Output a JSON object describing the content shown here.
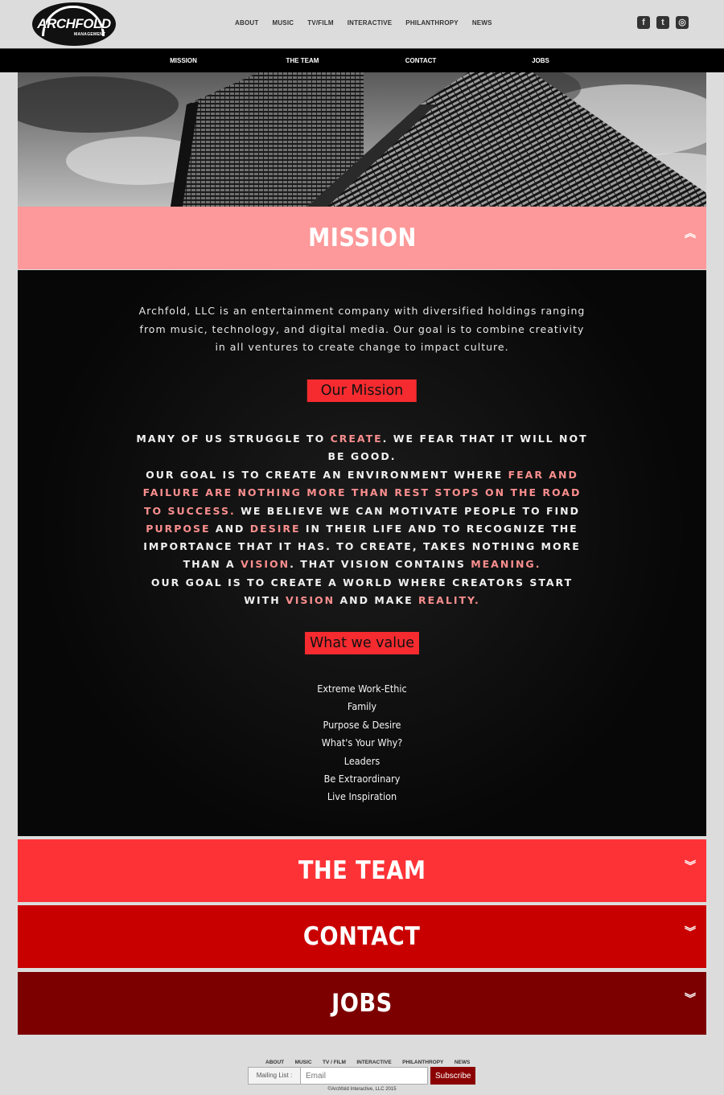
{
  "brand": {
    "logo_word": "ARCHFOLD",
    "logo_sub": "MANAGEMENT"
  },
  "topnav": [
    "ABOUT",
    "MUSIC",
    "TV/FILM",
    "INTERACTIVE",
    "PHILANTHROPY",
    "NEWS"
  ],
  "social": {
    "facebook": "f",
    "twitter": "t",
    "instagram": "◎"
  },
  "secnav": [
    "MISSION",
    "THE TEAM",
    "CONTACT",
    "JOBS"
  ],
  "mission": {
    "title": "MISSION",
    "intro": "Archfold, LLC is an entertainment company with diversified holdings ranging from music, technology, and digital media. Our goal is to combine creativity in all ventures to create change to impact culture.",
    "our_mission_label": "Our Mission",
    "p1": {
      "a": "MANY OF US STRUGGLE TO ",
      "b": "CREATE",
      "c": ". WE FEAR THAT IT WILL NOT BE GOOD."
    },
    "p2": {
      "a": "OUR GOAL IS TO CREATE AN ENVIRONMENT WHERE ",
      "b": "FEAR AND FAILURE ARE NOTHING MORE THAN REST STOPS ON THE ROAD TO SUCCESS.",
      "c": " WE BELIEVE WE CAN MOTIVATE PEOPLE TO FIND ",
      "d": "PURPOSE",
      "e": " AND ",
      "f": "DESIRE",
      "g": " IN THEIR LIFE AND TO RECOGNIZE THE IMPORTANCE THAT IT HAS. TO CREATE, TAKES NOTHING MORE THAN A ",
      "h": "VISION",
      "i": ". THAT VISION CONTAINS ",
      "j": "MEANING."
    },
    "p3": {
      "a": "OUR GOAL IS TO CREATE A WORLD WHERE CREATORS START WITH ",
      "b": "VISION",
      "c": " AND MAKE ",
      "d": "REALITY."
    },
    "values_label": "What we value",
    "values": [
      "Extreme Work-Ethic",
      "Family",
      "Purpose & Desire",
      "What's Your Why?",
      "Leaders",
      "Be Extraordinary",
      "Live Inspiration"
    ]
  },
  "panels": [
    {
      "title": "THE TEAM",
      "color": "#fd3236"
    },
    {
      "title": "CONTACT",
      "color": "#c90000"
    },
    {
      "title": "JOBS",
      "color": "#7d0000"
    }
  ],
  "colors": {
    "mission_head": "#fd999a",
    "highlight": "#fa8e8e",
    "pill": "#f52b2f"
  },
  "footer": {
    "nav": [
      "ABOUT",
      "MUSIC",
      "TV / FILM",
      "INTERACTIVE",
      "PHILANTHROPY",
      "NEWS"
    ],
    "mailing_label": "Mailing List :",
    "email_placeholder": "Email",
    "subscribe": "Subscribe",
    "copyright": "©Archfold Interactive, LLC 2015"
  }
}
